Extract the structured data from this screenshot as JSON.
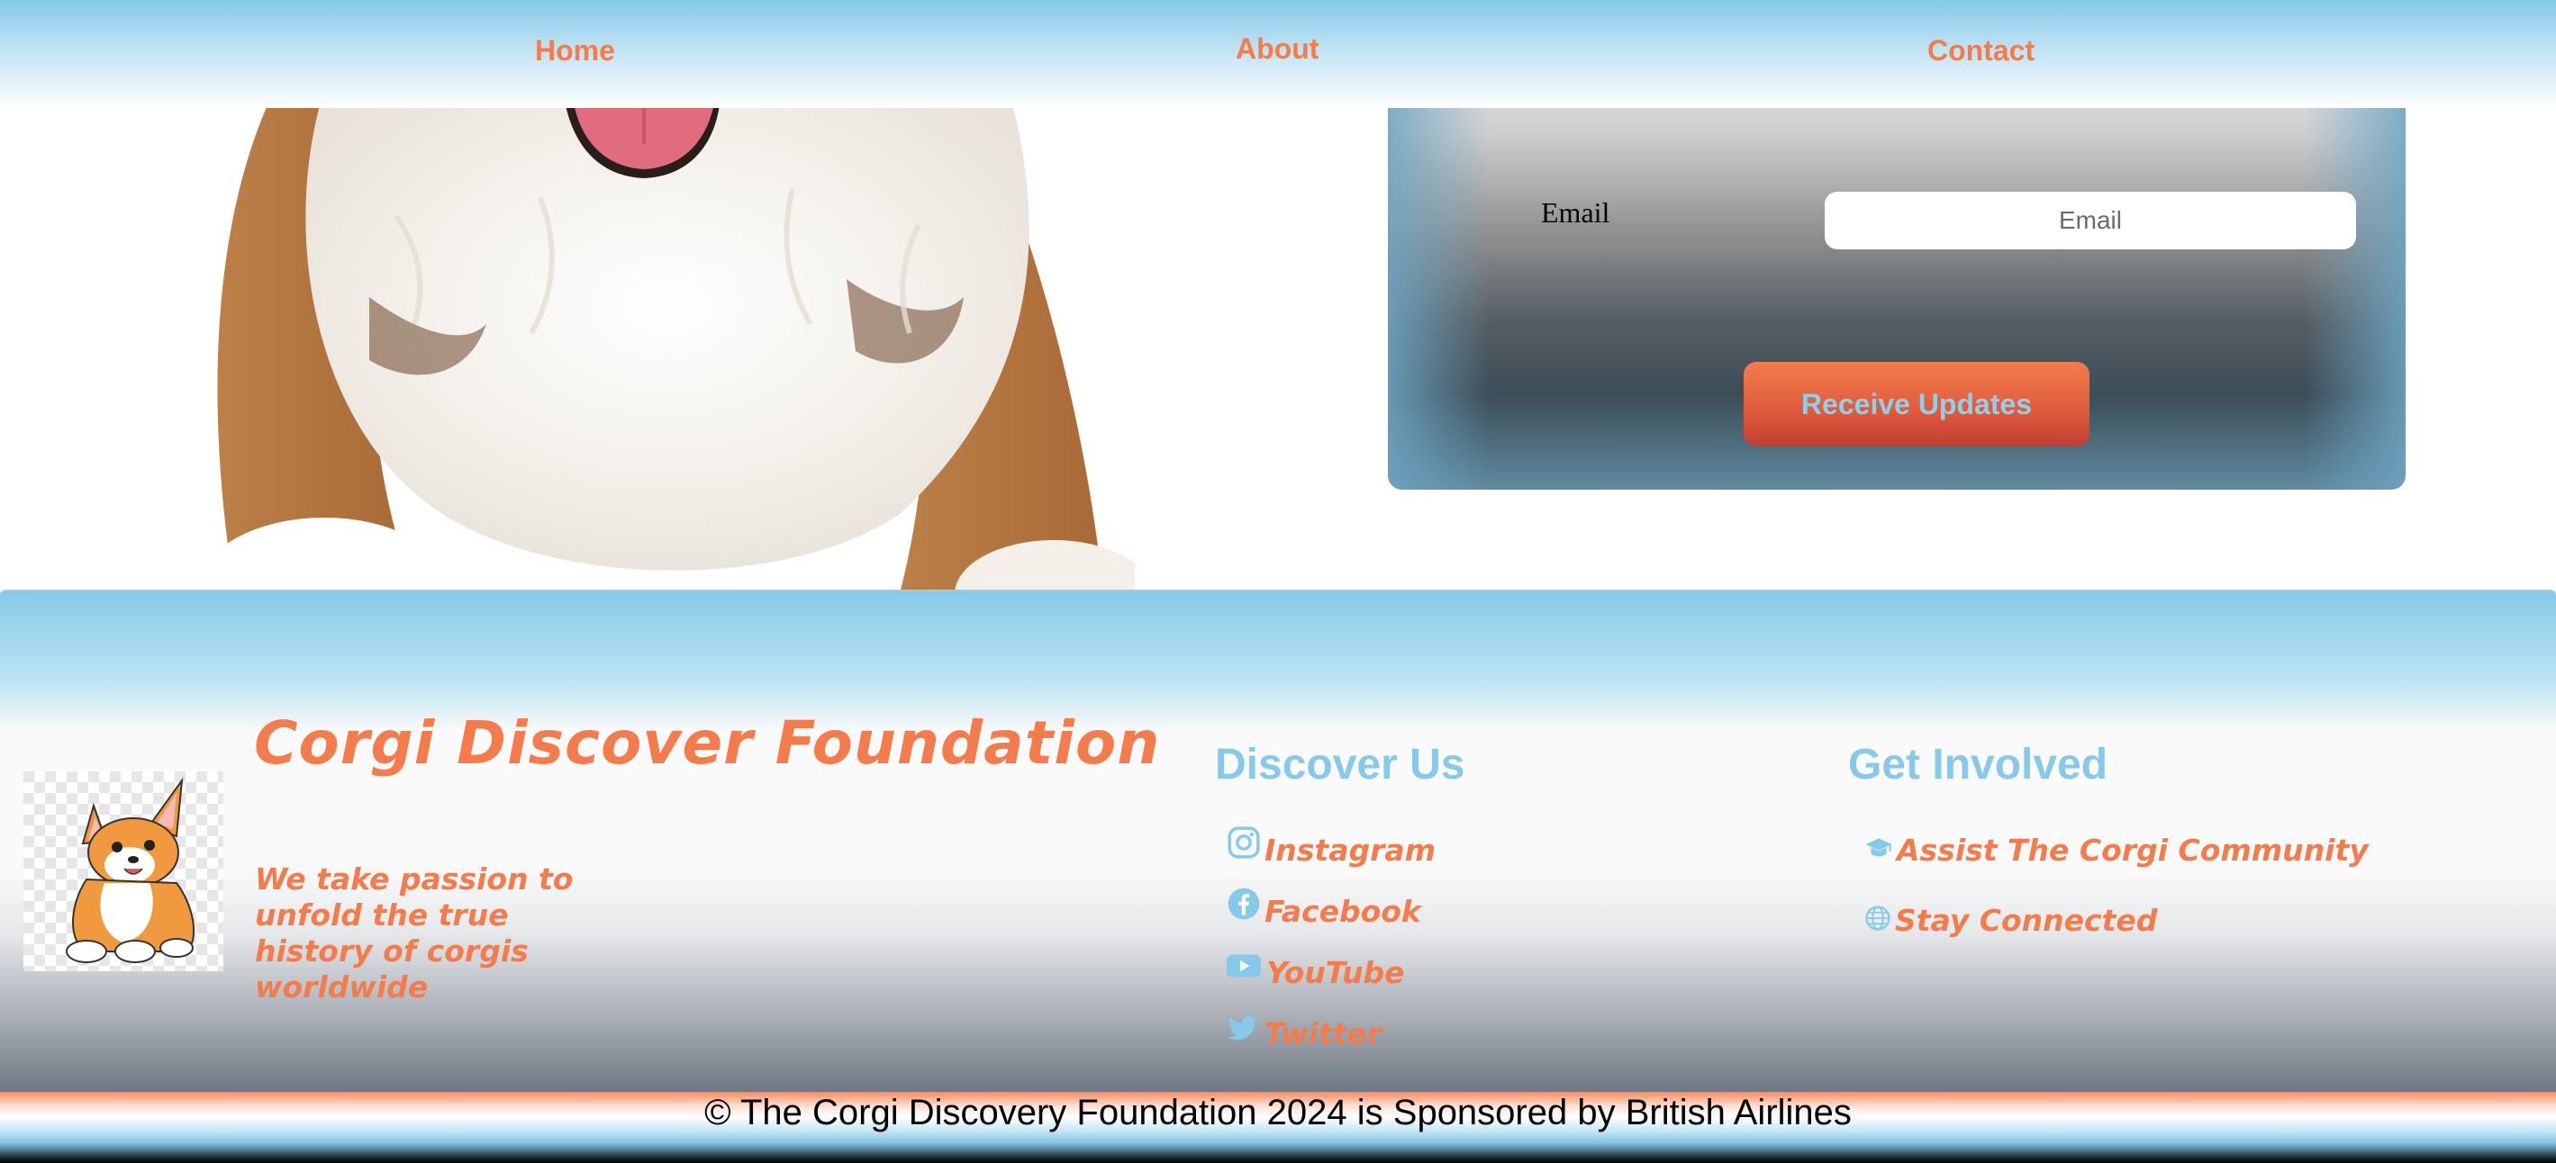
{
  "nav": {
    "home": "Home",
    "about": "About",
    "contact": "Contact"
  },
  "signup": {
    "email_label": "Email",
    "email_placeholder": "Email",
    "button_label": "Receive Updates"
  },
  "footer": {
    "brand": "Corgi Discover Foundation",
    "tagline": "We take passion to unfold the true history of corgis worldwide",
    "discover": {
      "heading": "Discover Us",
      "links": [
        {
          "label": "Instagram",
          "icon": "instagram-icon"
        },
        {
          "label": "Facebook",
          "icon": "facebook-icon"
        },
        {
          "label": "YouTube",
          "icon": "youtube-icon"
        },
        {
          "label": "Twitter",
          "icon": "twitter-icon"
        }
      ]
    },
    "involved": {
      "heading": "Get Involved",
      "links": [
        {
          "label": "Assist The Corgi Community",
          "icon": "graduation-cap-icon"
        },
        {
          "label": "Stay Connected",
          "icon": "globe-icon"
        }
      ]
    }
  },
  "copyright": "© The Corgi Discovery Foundation 2024 is Sponsored by British Airlines",
  "colors": {
    "accent_orange": "#f47c4c",
    "accent_blue": "#86c9e9"
  }
}
